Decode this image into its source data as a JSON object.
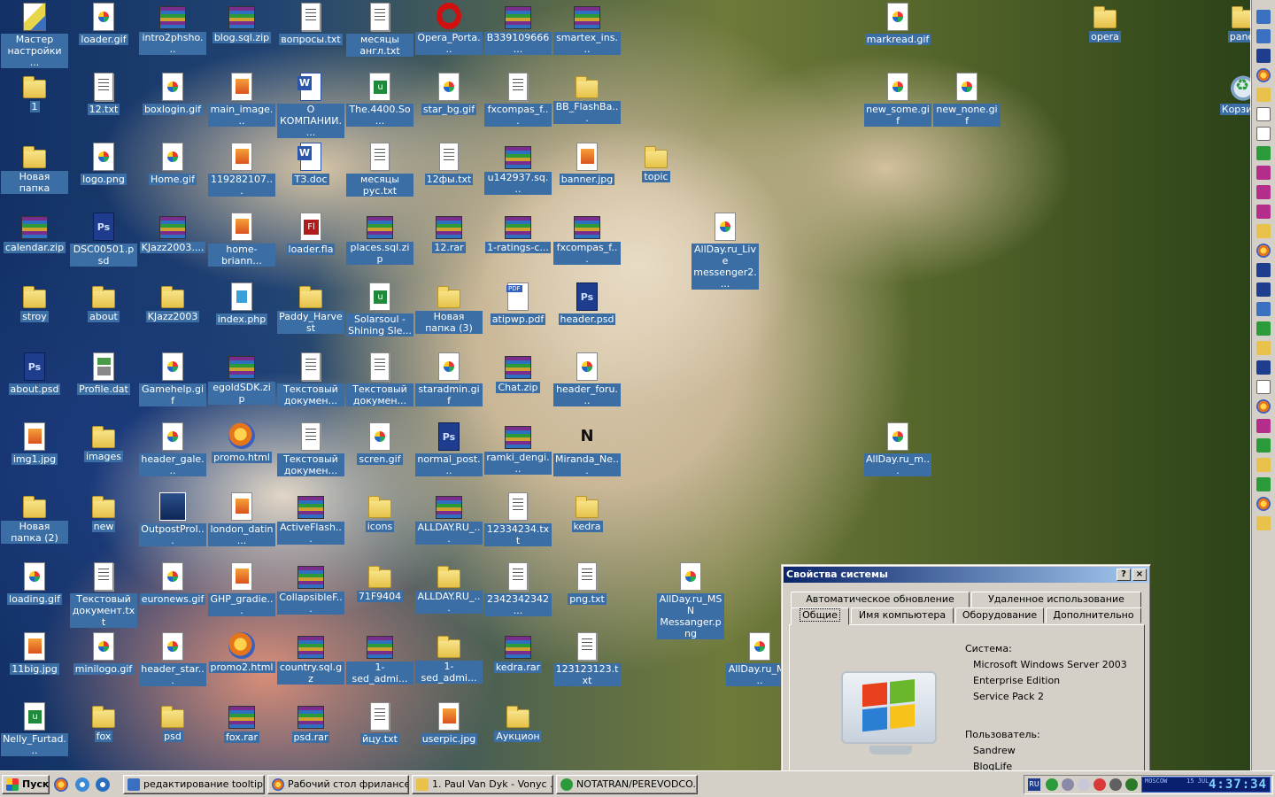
{
  "desktop": {
    "icons": [
      {
        "label": "Мастер настройки ...",
        "type": "wizard"
      },
      {
        "label": "loader.gif",
        "type": "img"
      },
      {
        "label": "intro2phsho...",
        "type": "rar"
      },
      {
        "label": "blog.sql.zip",
        "type": "rar"
      },
      {
        "label": "вопросы.txt",
        "type": "txt"
      },
      {
        "label": "месяцы англ.txt",
        "type": "txt"
      },
      {
        "label": "Opera_Porta...",
        "type": "opera"
      },
      {
        "label": "B339109666...",
        "type": "rar"
      },
      {
        "label": "smartex_ins...",
        "type": "rar"
      },
      {
        "label": "markread.gif",
        "type": "img"
      },
      {
        "label": "opera",
        "type": "folder"
      },
      {
        "label": "panel",
        "type": "folder"
      },
      {
        "label": "1",
        "type": "folder"
      },
      {
        "label": "12.txt",
        "type": "txt"
      },
      {
        "label": "boxlogin.gif",
        "type": "img"
      },
      {
        "label": "main_image...",
        "type": "jpg"
      },
      {
        "label": "О КОМПАНИИ....",
        "type": "doc"
      },
      {
        "label": "The.4400.So...",
        "type": "exe"
      },
      {
        "label": "star_bg.gif",
        "type": "img"
      },
      {
        "label": "fxcompas_f...",
        "type": "txt"
      },
      {
        "label": "BB_FlashBa...",
        "type": "folder"
      },
      {
        "label": "new_some.gif",
        "type": "img"
      },
      {
        "label": "new_none.gif",
        "type": "img"
      },
      {
        "label": "Корзина",
        "type": "recycle"
      },
      {
        "label": "Новая папка",
        "type": "folder"
      },
      {
        "label": "logo.png",
        "type": "img"
      },
      {
        "label": "Home.gif",
        "type": "img"
      },
      {
        "label": "119282107...",
        "type": "jpg"
      },
      {
        "label": "ТЗ.doc",
        "type": "doc"
      },
      {
        "label": "месяцы рус.txt",
        "type": "txt"
      },
      {
        "label": "12фы.txt",
        "type": "txt"
      },
      {
        "label": "u142937.sq...",
        "type": "rar"
      },
      {
        "label": "banner.jpg",
        "type": "jpg"
      },
      {
        "label": "topic",
        "type": "folder"
      },
      {
        "label": "calendar.zip",
        "type": "rar"
      },
      {
        "label": "DSC00501.psd",
        "type": "psd"
      },
      {
        "label": "KJazz2003....",
        "type": "rar"
      },
      {
        "label": "home-briann...",
        "type": "jpg"
      },
      {
        "label": "loader.fla",
        "type": "fla"
      },
      {
        "label": "places.sql.zip",
        "type": "rar"
      },
      {
        "label": "12.rar",
        "type": "rar"
      },
      {
        "label": "1-ratings-c...",
        "type": "rar"
      },
      {
        "label": "fxcompas_f...",
        "type": "rar"
      },
      {
        "label": "AllDay.ru_Live messenger2....",
        "type": "img"
      },
      {
        "label": "stroy",
        "type": "folder"
      },
      {
        "label": "about",
        "type": "folder"
      },
      {
        "label": "KJazz2003",
        "type": "folder"
      },
      {
        "label": "index.php",
        "type": "php"
      },
      {
        "label": "Paddy_Harvest",
        "type": "folder"
      },
      {
        "label": "Solarsoul - Shining Sle...",
        "type": "exe"
      },
      {
        "label": "Новая папка (3)",
        "type": "folder"
      },
      {
        "label": "atipwp.pdf",
        "type": "pdf"
      },
      {
        "label": "header.psd",
        "type": "psd"
      },
      {
        "label": "about.psd",
        "type": "psd"
      },
      {
        "label": "Profile.dat",
        "type": "dat"
      },
      {
        "label": "Gamehelp.gif",
        "type": "img"
      },
      {
        "label": "egoldSDK.zip",
        "type": "rar"
      },
      {
        "label": "Текстовый докумен...",
        "type": "txt"
      },
      {
        "label": "Текстовый докумен...",
        "type": "txt"
      },
      {
        "label": "staradmin.gif",
        "type": "img"
      },
      {
        "label": "Chat.zip",
        "type": "rar"
      },
      {
        "label": "header_foru...",
        "type": "img"
      },
      {
        "label": "img1.jpg",
        "type": "jpg"
      },
      {
        "label": "images",
        "type": "folder"
      },
      {
        "label": "header_gale...",
        "type": "img"
      },
      {
        "label": "promo.html",
        "type": "html"
      },
      {
        "label": "Текстовый докумен...",
        "type": "txt"
      },
      {
        "label": "scren.gif",
        "type": "img"
      },
      {
        "label": "normal_post...",
        "type": "psd"
      },
      {
        "label": "ramki_dengi...",
        "type": "rar"
      },
      {
        "label": "Miranda_Ne...",
        "type": "miranda"
      },
      {
        "label": "AllDay.ru_m...",
        "type": "img"
      },
      {
        "label": "Новая папка (2)",
        "type": "folder"
      },
      {
        "label": "new",
        "type": "folder"
      },
      {
        "label": "OutpostProI...",
        "type": "outpost"
      },
      {
        "label": "london_datin...",
        "type": "jpg"
      },
      {
        "label": "ActiveFlash...",
        "type": "rar"
      },
      {
        "label": "icons",
        "type": "folder"
      },
      {
        "label": "ALLDAY.RU_...",
        "type": "rar"
      },
      {
        "label": "12334234.txt",
        "type": "txt"
      },
      {
        "label": "kedra",
        "type": "folder"
      },
      {
        "label": "loading.gif",
        "type": "img"
      },
      {
        "label": "Текстовый документ.txt",
        "type": "txt"
      },
      {
        "label": "euronews.gif",
        "type": "img"
      },
      {
        "label": "GHP_gradie...",
        "type": "jpg"
      },
      {
        "label": "CollapsibleF...",
        "type": "rar"
      },
      {
        "label": "71F9404",
        "type": "folder"
      },
      {
        "label": "ALLDAY.RU_...",
        "type": "folder"
      },
      {
        "label": "2342342342...",
        "type": "txt"
      },
      {
        "label": "png.txt",
        "type": "txt"
      },
      {
        "label": "AllDay.ru_MSN Messanger.png",
        "type": "img"
      },
      {
        "label": "11big.jpg",
        "type": "jpg"
      },
      {
        "label": "minilogo.gif",
        "type": "img"
      },
      {
        "label": "header_star...",
        "type": "img"
      },
      {
        "label": "promo2.html",
        "type": "html"
      },
      {
        "label": "country.sql.gz",
        "type": "rar"
      },
      {
        "label": "1-sed_admi...",
        "type": "rar"
      },
      {
        "label": "1-sed_admi...",
        "type": "folder"
      },
      {
        "label": "kedra.rar",
        "type": "rar"
      },
      {
        "label": "123123123.txt",
        "type": "txt"
      },
      {
        "label": "AllDay.ru_MI...",
        "type": "img"
      },
      {
        "label": "Nelly_Furtad...",
        "type": "exe"
      },
      {
        "label": "fox",
        "type": "folder"
      },
      {
        "label": "psd",
        "type": "folder"
      },
      {
        "label": "fox.rar",
        "type": "rar"
      },
      {
        "label": "psd.rar",
        "type": "rar"
      },
      {
        "label": "йцу.txt",
        "type": "txt"
      },
      {
        "label": "userpic.jpg",
        "type": "jpg"
      },
      {
        "label": "Аукцион",
        "type": "folder"
      }
    ]
  },
  "sysprop": {
    "title": "Свойства системы",
    "help_btn": "?",
    "close_btn": "×",
    "tabs_row1": [
      "Автоматическое обновление",
      "Удаленное использование"
    ],
    "tabs_row2": [
      "Общие",
      "Имя компьютера",
      "Оборудование",
      "Дополнительно"
    ],
    "system_heading": "Система:",
    "os_name": "Microsoft Windows Server 2003",
    "edition": "Enterprise Edition",
    "service_pack": "Service Pack 2",
    "user_heading": "Пользователь:",
    "user_name": "Sandrew",
    "org": "BlogLife"
  },
  "taskbar": {
    "start_label": "Пуск",
    "tasks": [
      "редактирование tooltip...",
      "Рабочий стол фрилансе...",
      "1. Paul Van Dyk - Vonyc ...",
      "NOTATRAN/PEREVODCO..."
    ],
    "lang": "RU",
    "clock_city": "MOSCOW",
    "clock_date": "15 JUL",
    "clock_time": "4:37:34"
  },
  "colors": {
    "icon_label_bg": "#3a6ea5",
    "title_bar_start": "#0a246a",
    "title_bar_end": "#a6caf0",
    "face": "#d4d0c8"
  }
}
